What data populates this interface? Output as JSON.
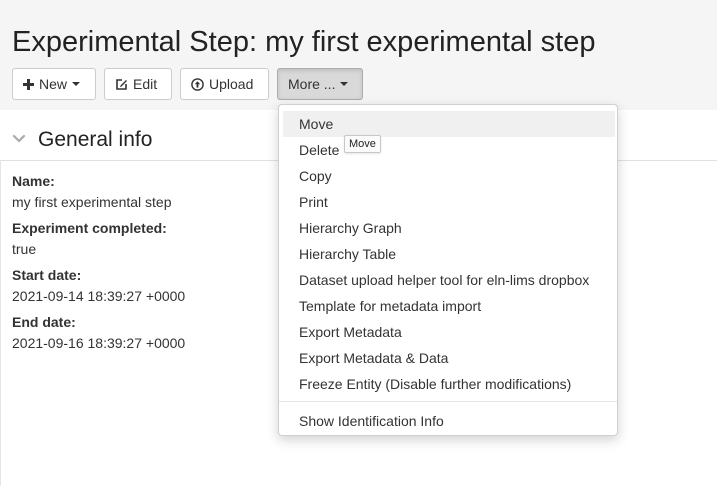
{
  "page": {
    "title": "Experimental Step: my first experimental step"
  },
  "toolbar": {
    "new_label": "New",
    "edit_label": "Edit",
    "upload_label": "Upload",
    "more_label": "More ..."
  },
  "section": {
    "title": "General info"
  },
  "properties": [
    {
      "label": "Name:",
      "value": "my first experimental step"
    },
    {
      "label": "Experiment completed:",
      "value": "true"
    },
    {
      "label": "Start date:",
      "value": "2021-09-14 18:39:27 +0000"
    },
    {
      "label": "End date:",
      "value": "2021-09-16 18:39:27 +0000"
    }
  ],
  "more_menu": {
    "items": [
      "Move",
      "Delete",
      "Copy",
      "Print",
      "Hierarchy Graph",
      "Hierarchy Table",
      "Dataset upload helper tool for eln-lims dropbox",
      "Template for metadata import",
      "Export Metadata",
      "Export Metadata & Data",
      "Freeze Entity (Disable further modifications)"
    ],
    "footer_item": "Show Identification Info",
    "hovered_item": "Move"
  },
  "tooltip": {
    "text": "Move"
  },
  "icons": {
    "new": "plus-icon",
    "edit": "edit-icon",
    "upload": "upload-circle-icon",
    "section_toggle": "chevron-down-icon"
  }
}
